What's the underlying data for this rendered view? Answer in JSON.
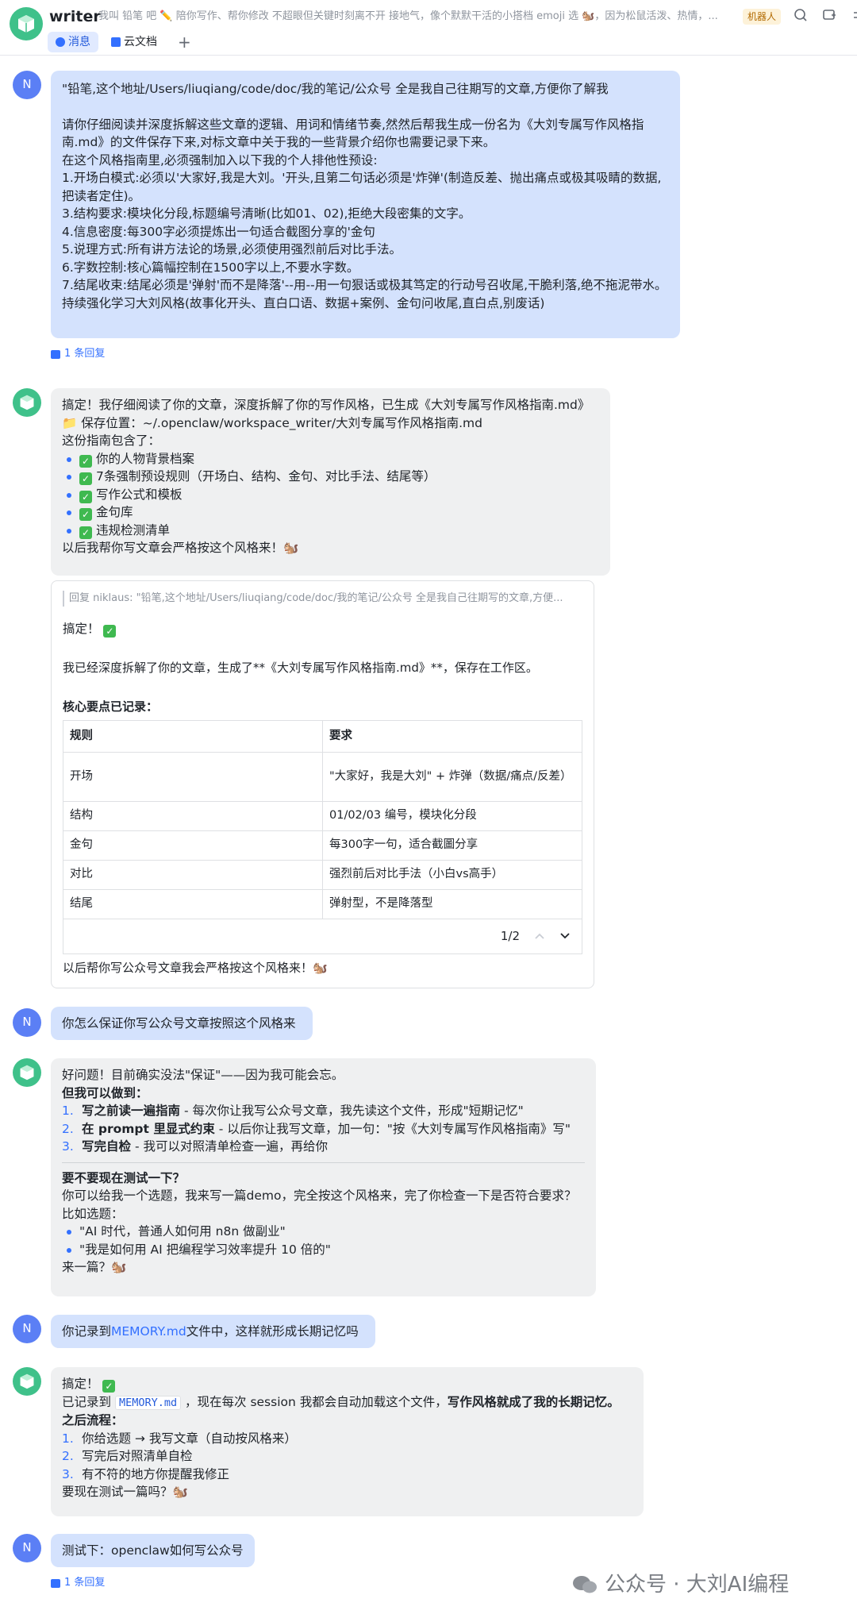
{
  "header": {
    "name": "writer",
    "description": "我叫 铅笔 吧 ✏️ 陪你写作、帮你修改 不超眼但关键时刻离不开 接地气，像个默默干活的小搭档 emoji 选 🐿️，因为松鼠活泼、热情，...",
    "badge": "机器人",
    "tabs": [
      {
        "label": "消息"
      },
      {
        "label": "云文档"
      }
    ],
    "add_tab": "+"
  },
  "messages": {
    "m1": {
      "avatar": "N",
      "lines": [
        "\"铅笔,这个地址/Users/liuqiang/code/doc/我的笔记/公众号 全是我自己往期写的文章,方便你了解我",
        "",
        "请你仔细阅读并深度拆解这些文章的逻辑、用词和情绪节奏,然然后帮我生成一份名为《大刘专属写作风格指南.md》的文件保存下来,对标文章中关于我的一些背景介绍你也需要记录下来。",
        "在这个风格指南里,必须强制加入以下我的个人排他性预设:",
        "1.开场白模式:必须以'大家好,我是大刘。'开头,且第二句话必须是'炸弹'(制造反差、抛出痛点或极其吸睛的数据,把读者定住)。",
        "3.结构要求:模块化分段,标题编号清晰(比如01、02),拒绝大段密集的文字。",
        "4.信息密度:每300字必须提炼出一句适合截图分享的'金句",
        "5.说理方式:所有讲方法论的场景,必须使用强烈前后对比手法。",
        "6.字数控制:核心篇幅控制在1500字以上,不要水字数。",
        "7.结尾收束:结尾必须是'弹射'而不是降落'--用--用一句狠话或极其笃定的行动号召收尾,干脆利落,绝不拖泥带水。",
        "持续强化学习大刘风格(故事化开头、直白口语、数据+案例、金句问收尾,直白点,别废话)"
      ],
      "reply_count": "1 条回复"
    },
    "m2": {
      "intro": "搞定！我仔细阅读了你的文章，深度拆解了你的写作风格，已生成《大刘专属写作风格指南.md》",
      "save": "📁 保存位置：~/.openclaw/workspace_writer/大刘专属写作风格指南.md",
      "contains": "这份指南包含了：",
      "items": [
        "你的人物背景档案",
        "7条强制预设规则（开场白、结构、金句、对比手法、结尾等）",
        "写作公式和模板",
        "金句库",
        "违规检测清单"
      ],
      "outro": "以后我帮你写文章会严格按这个风格来！🐿️"
    },
    "card": {
      "quote": "回复 niklaus: \"铅笔,这个地址/Users/liuqiang/code/doc/我的笔记/公众号 全是我自己往期写的文章,方便...",
      "done": "搞定！",
      "desc": "我已经深度拆解了你的文章，生成了**《大刘专属写作风格指南.md》**，保存在工作区。",
      "heading": "核心要点已记录：",
      "table_headers": [
        "规则",
        "要求"
      ],
      "rows": [
        [
          "开场",
          "\"大家好，我是大刘\" + 炸弹（数据/痛点/反差）"
        ],
        [
          "结构",
          "01/02/03 编号，模块化分段"
        ],
        [
          "金句",
          "每300字一句，适合截圖分享"
        ],
        [
          "对比",
          "强烈前后对比手法（小白vs高手）"
        ],
        [
          "结尾",
          "弹射型，不是降落型"
        ]
      ],
      "page": "1/2",
      "outro": "以后帮你写公众号文章我会严格按这个风格来！🐿️"
    },
    "m3": {
      "avatar": "N",
      "text": "你怎么保证你写公众号文章按照这个风格来"
    },
    "m4": {
      "l1": "好问题！目前确实没法\"保证\"——因为我可能会忘。",
      "l2": "但我可以做到：",
      "items": [
        {
          "num": "1.",
          "bold": "写之前读一遍指南",
          "rest": " - 每次你让我写公众号文章，我先读这个文件，形成\"短期记忆\""
        },
        {
          "num": "2.",
          "bold": "在 prompt 里显式约束",
          "rest": " - 以后你让我写文章，加一句：\"按《大刘专属写作风格指南》写\""
        },
        {
          "num": "3.",
          "bold": "写完自检",
          "rest": " - 我可以对照清单检查一遍，再给你"
        }
      ],
      "q": "要不要现在测试一下？",
      "l3": "你可以给我一个选题，我来写一篇demo，完全按这个风格来，完了你检查一下是否符合要求？",
      "l4": "比如选题：",
      "topics": [
        "\"AI 时代，普通人如何用 n8n 做副业\"",
        "\"我是如何用 AI 把编程学习效率提升 10 倍的\""
      ],
      "end": "来一篇？🐿️"
    },
    "m5": {
      "avatar": "N",
      "pre": "你记录到",
      "link": "MEMORY.md",
      "post": "文件中，这样就形成长期记忆吗"
    },
    "m6": {
      "done": "搞定！",
      "l2a": "已记录到 ",
      "code": "MEMORY.md",
      "l2b": " ，现在每次 session 我都会自动加载这个文件，",
      "l2bold": "写作风格就成了我的长期记忆。",
      "l3": "之后流程：",
      "items": [
        {
          "num": "1.",
          "text": "你给选题 → 我写文章（自动按风格来）"
        },
        {
          "num": "2.",
          "text": "写完后对照清单自检"
        },
        {
          "num": "3.",
          "text": "有不符的地方你提醒我修正"
        }
      ],
      "end": "要现在测试一篇吗？🐿️"
    },
    "m7": {
      "avatar": "N",
      "text": "测试下：openclaw如何写公众号",
      "reply_count": "1 条回复"
    }
  },
  "watermark": "公众号 · 大刘AI编程",
  "colors": {
    "user_bubble": "#d4e2fd",
    "bot_bubble": "#eff0f1",
    "accent": "#3370ff",
    "bot_avatar": "#3fc18a",
    "user_avatar": "#5b7ff5"
  }
}
